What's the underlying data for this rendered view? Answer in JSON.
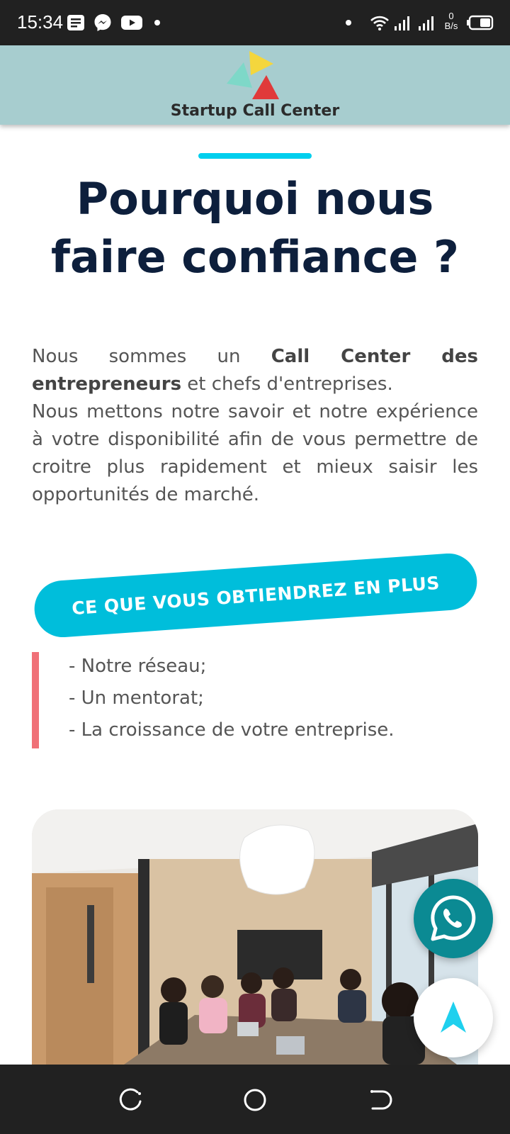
{
  "status_bar": {
    "time": "15:34",
    "net_speed_value": "0",
    "net_speed_unit": "B/s",
    "icons": [
      "notes-icon",
      "messenger-icon",
      "youtube-icon",
      "wifi-icon",
      "signal-icon",
      "signal-icon",
      "battery-icon"
    ]
  },
  "header": {
    "brand": "Startup Call Center",
    "logo_colors": [
      "#f4d63d",
      "#7ed8c8",
      "#e03a3a"
    ]
  },
  "main": {
    "title_line1": "Pourquoi nous",
    "title_line2": "faire confiance ?",
    "intro": {
      "p1_prefix": "Nous sommes un ",
      "p1_bold": "Call Center des entrepreneurs",
      "p1_suffix": " et chefs d'entreprises.",
      "p2": "Nous mettons notre savoir et notre expérience à votre disponibilité afin de vous permettre de croitre plus rapidement et mieux saisir les opportunités de marché."
    },
    "cta_label": "CE QUE VOUS OBTIENDREZ EN PLUS",
    "benefits": [
      "- Notre réseau;",
      "- Un mentorat;",
      "- La croissance de votre entreprise."
    ]
  },
  "floating": {
    "whatsapp_icon": "whatsapp-icon",
    "scroll_top_icon": "arrow-up-icon"
  },
  "colors": {
    "accent": "#00bedb",
    "title": "#0d1f3c",
    "header_bg": "#a7cdcf",
    "quote_bar": "#f07077",
    "whatsapp": "#0b8a93"
  }
}
